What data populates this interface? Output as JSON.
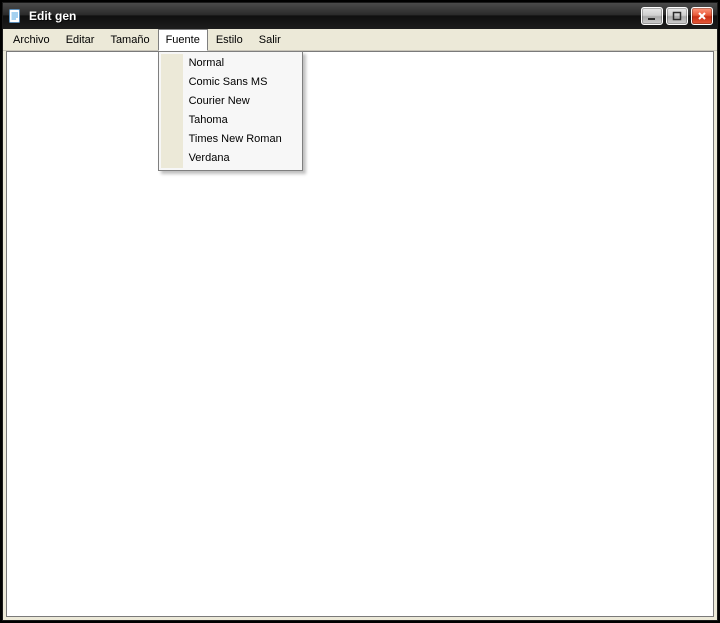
{
  "window": {
    "title": "Edit gen"
  },
  "menubar": {
    "items": [
      {
        "label": "Archivo"
      },
      {
        "label": "Editar"
      },
      {
        "label": "Tamaño"
      },
      {
        "label": "Fuente"
      },
      {
        "label": "Estilo"
      },
      {
        "label": "Salir"
      }
    ],
    "open_index": 3
  },
  "dropdown": {
    "items": [
      {
        "label": "Normal"
      },
      {
        "label": "Comic Sans MS"
      },
      {
        "label": "Courier New"
      },
      {
        "label": "Tahoma"
      },
      {
        "label": "Times New Roman"
      },
      {
        "label": "Verdana"
      }
    ]
  },
  "editor": {
    "value": ""
  }
}
